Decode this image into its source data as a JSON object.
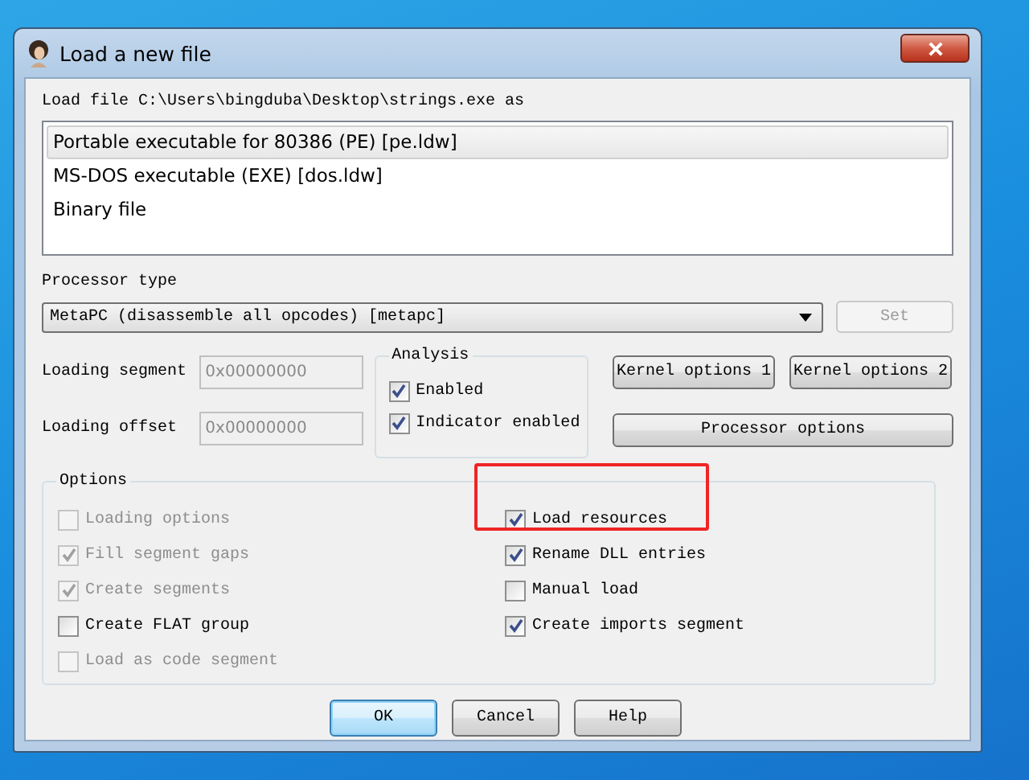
{
  "window": {
    "title": "Load a new file"
  },
  "load_label": "Load file C:\\Users\\bingduba\\Desktop\\strings.exe as",
  "formats": [
    {
      "label": "Portable executable for 80386 (PE) [pe.ldw]",
      "selected": true
    },
    {
      "label": "MS-DOS executable (EXE) [dos.ldw]",
      "selected": false
    },
    {
      "label": "Binary file",
      "selected": false
    }
  ],
  "processor": {
    "label": "Processor type",
    "value": "MetaPC (disassemble all opcodes) [metapc]",
    "set_button": {
      "label": "Set",
      "disabled": true
    }
  },
  "loading_segment": {
    "label": "Loading segment",
    "value": "0x00000000",
    "disabled": true
  },
  "loading_offset": {
    "label": "Loading offset",
    "value": "0x00000000",
    "disabled": true
  },
  "analysis": {
    "title": "Analysis",
    "items": [
      {
        "label": "Enabled",
        "checked": true
      },
      {
        "label": "Indicator enabled",
        "checked": true
      }
    ]
  },
  "kernel_buttons": [
    "Kernel options 1",
    "Kernel options 2"
  ],
  "processor_options_button": "Processor options",
  "options": {
    "title": "Options",
    "left": [
      {
        "label": "Loading options",
        "checked": false,
        "disabled": true
      },
      {
        "label": "Fill segment gaps",
        "checked": true,
        "disabled": true
      },
      {
        "label": "Create segments",
        "checked": true,
        "disabled": true
      },
      {
        "label": "Create FLAT group",
        "checked": false,
        "disabled": false
      },
      {
        "label": "Load as code segment",
        "checked": false,
        "disabled": true
      }
    ],
    "right": [
      {
        "label": "Load resources",
        "checked": true,
        "disabled": false,
        "highlighted": true
      },
      {
        "label": "Rename DLL entries",
        "checked": true,
        "disabled": false,
        "highlighted": false
      },
      {
        "label": "Manual load",
        "checked": false,
        "disabled": false,
        "highlighted": false
      },
      {
        "label": "Create imports segment",
        "checked": true,
        "disabled": false,
        "highlighted": false
      }
    ]
  },
  "buttons": [
    {
      "label": "OK",
      "default": true
    },
    {
      "label": "Cancel",
      "default": false
    },
    {
      "label": "Help",
      "default": false
    }
  ]
}
